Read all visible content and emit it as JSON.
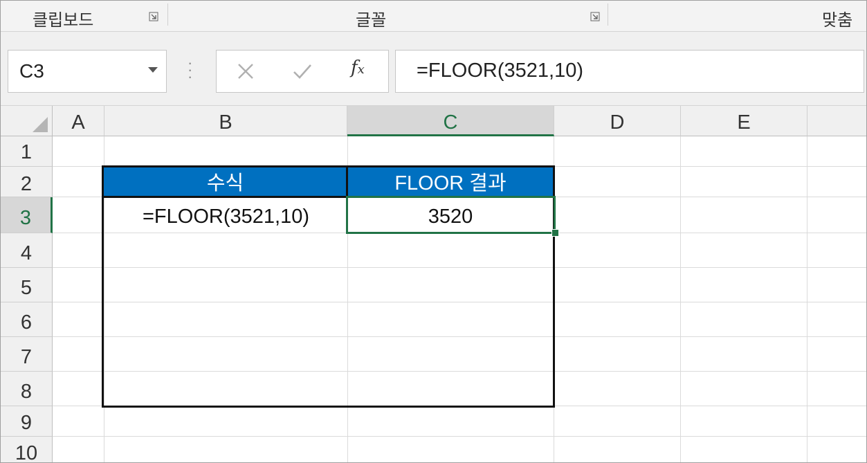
{
  "ribbon": {
    "groups": [
      "클립보드",
      "글꼴",
      "맞춤"
    ]
  },
  "formula_bar": {
    "name_box": "C3",
    "fx_label": "fx",
    "formula": "=FLOOR(3521,10)"
  },
  "sheet": {
    "columns": [
      "A",
      "B",
      "C",
      "D",
      "E"
    ],
    "rows": [
      "1",
      "2",
      "3",
      "4",
      "5",
      "6",
      "7",
      "8",
      "9",
      "10"
    ],
    "selected_cell": "C3",
    "table": {
      "header_formula": "수식",
      "header_result": "FLOOR 결과",
      "row_formula": "=FLOOR(3521,10)",
      "row_result": "3520"
    }
  },
  "colors": {
    "header_fill": "#0070c0",
    "selection": "#217346"
  }
}
